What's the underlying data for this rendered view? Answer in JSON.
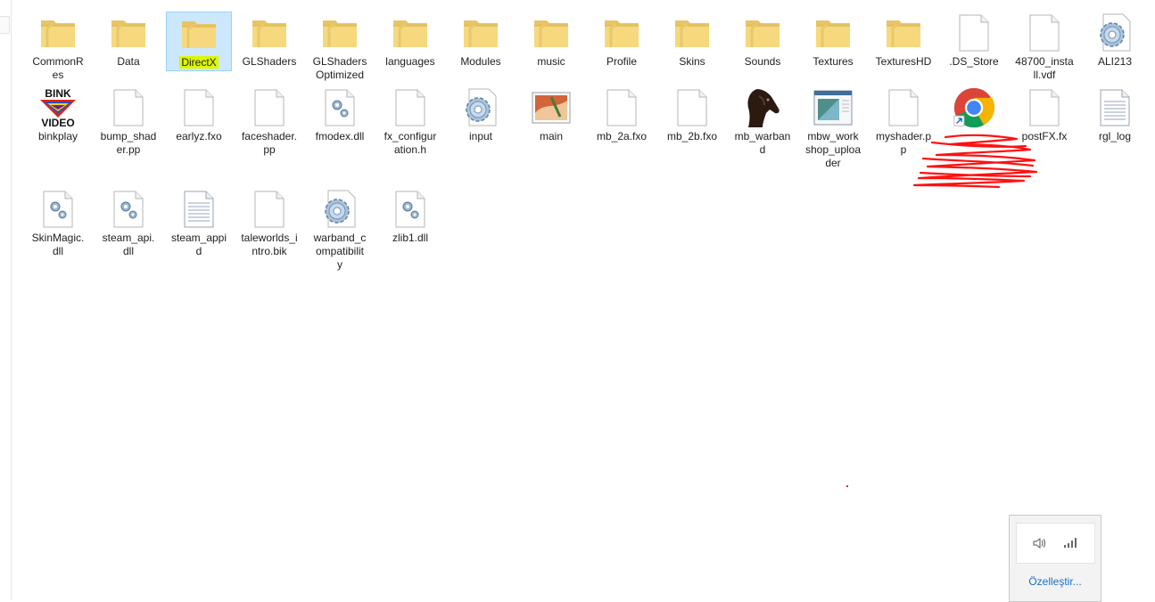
{
  "window": {
    "title": ""
  },
  "files": [
    {
      "name": "CommonRes",
      "label": "CommonR\nes",
      "type": "folder"
    },
    {
      "name": "Data",
      "label": "Data",
      "type": "folder"
    },
    {
      "name": "DirectX",
      "label": "DirectX",
      "type": "folder",
      "selected": true
    },
    {
      "name": "GLShaders",
      "label": "GLShaders",
      "type": "folder"
    },
    {
      "name": "GLShaders Optimized",
      "label": "GLShaders\nOptimized",
      "type": "folder"
    },
    {
      "name": "languages",
      "label": "languages",
      "type": "folder"
    },
    {
      "name": "Modules",
      "label": "Modules",
      "type": "folder"
    },
    {
      "name": "music",
      "label": "music",
      "type": "folder"
    },
    {
      "name": "Profile",
      "label": "Profile",
      "type": "folder"
    },
    {
      "name": "Skins",
      "label": "Skins",
      "type": "folder"
    },
    {
      "name": "Sounds",
      "label": "Sounds",
      "type": "folder"
    },
    {
      "name": "Textures",
      "label": "Textures",
      "type": "folder"
    },
    {
      "name": "TexturesHD",
      "label": "TexturesHD",
      "type": "folder"
    },
    {
      "name": ".DS_Store",
      "label": ".DS_Store",
      "type": "file"
    },
    {
      "name": "48700_install.vdf",
      "label": "48700_insta\nll.vdf",
      "type": "file"
    },
    {
      "name": "ALI213",
      "label": "ALI213",
      "type": "gear"
    },
    {
      "name": "binkplay",
      "label": "binkplay",
      "type": "bink"
    },
    {
      "name": "bump_shader.pp",
      "label": "bump_shad\ner.pp",
      "type": "file"
    },
    {
      "name": "earlyz.fxo",
      "label": "earlyz.fxo",
      "type": "file"
    },
    {
      "name": "faceshader.pp",
      "label": "faceshader.\npp",
      "type": "file"
    },
    {
      "name": "fmodex.dll",
      "label": "fmodex.dll",
      "type": "dll"
    },
    {
      "name": "fx_configuration.h",
      "label": "fx_configur\nation.h",
      "type": "file"
    },
    {
      "name": "input",
      "label": "input",
      "type": "gear"
    },
    {
      "name": "main",
      "label": "main",
      "type": "image"
    },
    {
      "name": "mb_2a.fxo",
      "label": "mb_2a.fxo",
      "type": "file"
    },
    {
      "name": "mb_2b.fxo",
      "label": "mb_2b.fxo",
      "type": "file"
    },
    {
      "name": "mb_warband",
      "label": "mb_warban\nd",
      "type": "horse"
    },
    {
      "name": "mbw_workshop_uploader",
      "label": "mbw_work\nshop_uploa\nder",
      "type": "window"
    },
    {
      "name": "myshader.pp",
      "label": "myshader.p\np",
      "type": "file"
    },
    {
      "name": "chrome-shortcut",
      "label": "",
      "type": "chrome"
    },
    {
      "name": "postFX.fx",
      "label": "postFX.fx",
      "type": "file"
    },
    {
      "name": "rgl_log",
      "label": "rgl_log",
      "type": "text"
    },
    {
      "name": "SkinMagic.dll",
      "label": "SkinMagic.\ndll",
      "type": "dll"
    },
    {
      "name": "steam_api.dll",
      "label": "steam_api.\ndll",
      "type": "dll"
    },
    {
      "name": "steam_appid",
      "label": "steam_appi\nd",
      "type": "text"
    },
    {
      "name": "taleworlds_intro.bik",
      "label": "taleworlds_i\nntro.bik",
      "type": "file"
    },
    {
      "name": "warband_compatibility",
      "label": "warband_c\nompatibilit\ny",
      "type": "gear"
    },
    {
      "name": "zlib1.dll",
      "label": "zlib1.dll",
      "type": "dll"
    }
  ],
  "tray": {
    "customize_label": "Özelleştir..."
  },
  "colors": {
    "selection_bg": "#cce8ff",
    "selection_border": "#99d1ff",
    "highlight": "#dcf700",
    "link": "#1a6fc9"
  }
}
